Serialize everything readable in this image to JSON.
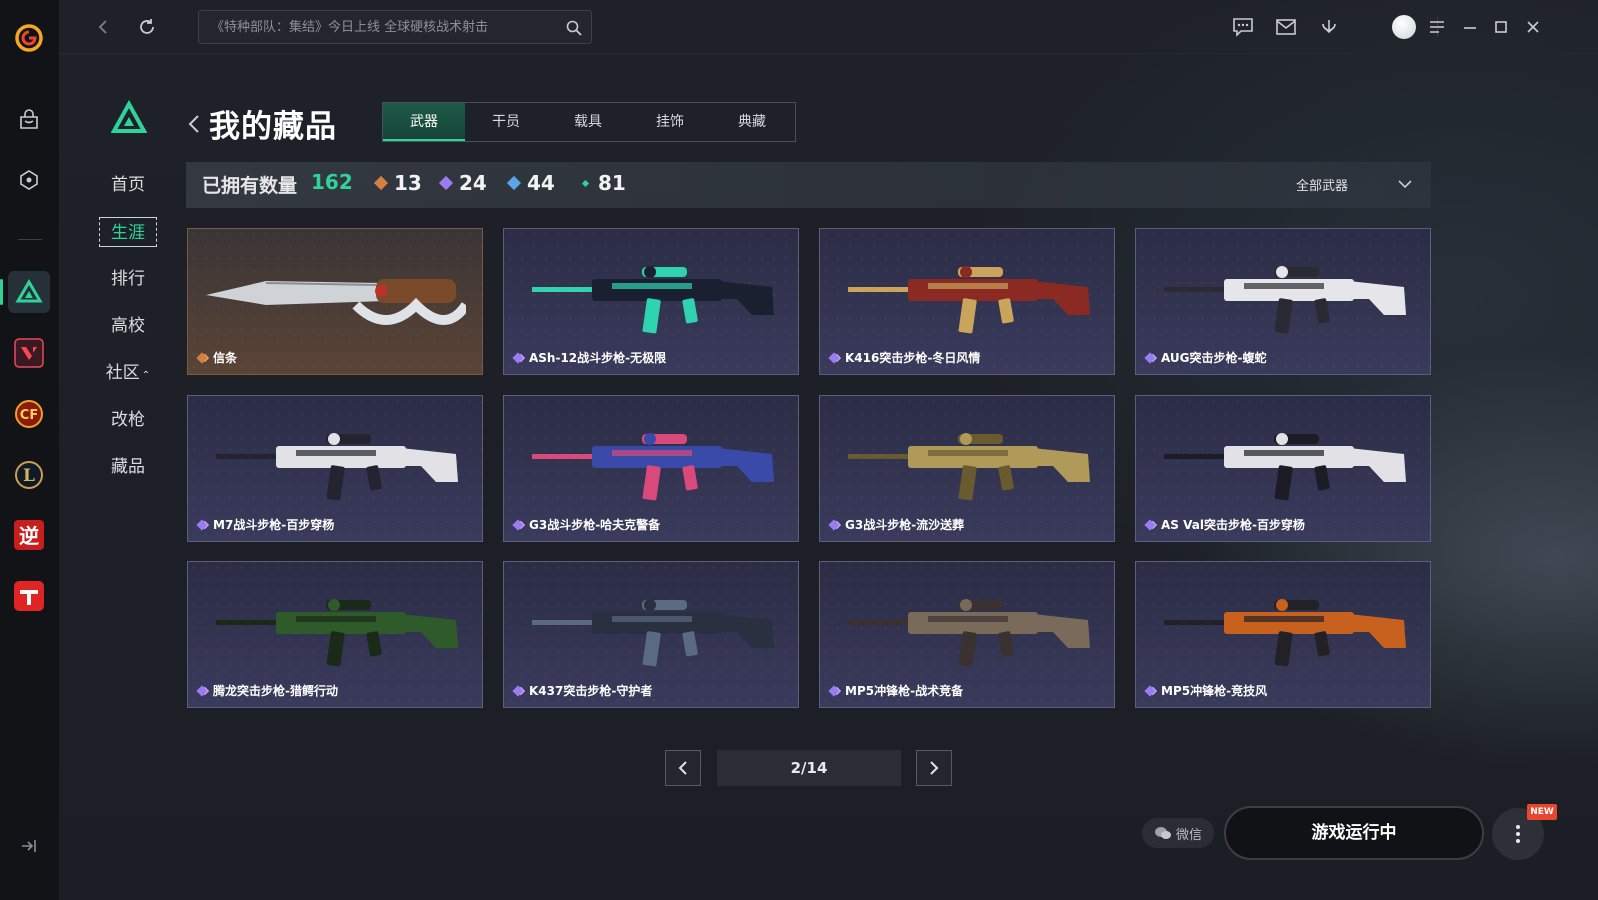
{
  "topbar": {
    "search_placeholder": "《特种部队：集结》今日上线 全球硬核战术射击"
  },
  "nav": {
    "items": [
      {
        "label": "首页",
        "active": false
      },
      {
        "label": "生涯",
        "active": true
      },
      {
        "label": "排行",
        "active": false
      },
      {
        "label": "高校",
        "active": false
      },
      {
        "label": "社区",
        "active": false,
        "caret": "⌃"
      },
      {
        "label": "改枪",
        "active": false
      },
      {
        "label": "藏品",
        "active": false
      }
    ]
  },
  "header": {
    "title": "我的藏品",
    "tabs": [
      "武器",
      "干员",
      "载具",
      "挂饰",
      "典藏"
    ],
    "active_tab": "武器"
  },
  "stats": {
    "label": "已拥有数量",
    "total": "162",
    "counts": [
      {
        "value": "13",
        "color": "#d4803e"
      },
      {
        "value": "24",
        "color": "#9a7cf0"
      },
      {
        "value": "44",
        "color": "#5aa4e8"
      },
      {
        "value": "81",
        "color": "#2fd39a"
      }
    ],
    "filter_label": "全部武器"
  },
  "items": [
    {
      "name": "信条",
      "rarity": "gold",
      "gun_color": "#cfd2d6",
      "accent": "#7a4a2a"
    },
    {
      "name": "ASh-12战斗步枪-无极限",
      "rarity": "purple",
      "gun_color": "#1a2030",
      "accent": "#2fd3b0"
    },
    {
      "name": "K416突击步枪-冬日风情",
      "rarity": "purple",
      "gun_color": "#8b2a22",
      "accent": "#c9a45a"
    },
    {
      "name": "AUG突击步枪-蝮蛇",
      "rarity": "purple",
      "gun_color": "#e6e6ea",
      "accent": "#2a2a32"
    },
    {
      "name": "M7战斗步枪-百步穿杨",
      "rarity": "purple",
      "gun_color": "#e2e2e6",
      "accent": "#232430"
    },
    {
      "name": "G3战斗步枪-哈夫克警备",
      "rarity": "purple",
      "gun_color": "#3a4aa8",
      "accent": "#d94a7a"
    },
    {
      "name": "G3战斗步枪-流沙送葬",
      "rarity": "purple",
      "gun_color": "#b09a5a",
      "accent": "#6a5a30"
    },
    {
      "name": "AS Val突击步枪-百步穿杨",
      "rarity": "purple",
      "gun_color": "#e2e2e6",
      "accent": "#1c1c26"
    },
    {
      "name": "腾龙突击步枪-猎鳄行动",
      "rarity": "purple",
      "gun_color": "#2f5a2a",
      "accent": "#1a2a18"
    },
    {
      "name": "K437突击步枪-守护者",
      "rarity": "purple",
      "gun_color": "#2a3040",
      "accent": "#5a6a80"
    },
    {
      "name": "MP5冲锋枪-战术竞备",
      "rarity": "purple",
      "gun_color": "#7a6a5a",
      "accent": "#3a3230"
    },
    {
      "name": "MP5冲锋枪-竞技风",
      "rarity": "purple",
      "gun_color": "#c8601e",
      "accent": "#222226"
    }
  ],
  "pagination": {
    "label": "2/14"
  },
  "bottom": {
    "wechat_label": "微信",
    "run_label": "游戏运行中",
    "new_badge": "NEW"
  }
}
